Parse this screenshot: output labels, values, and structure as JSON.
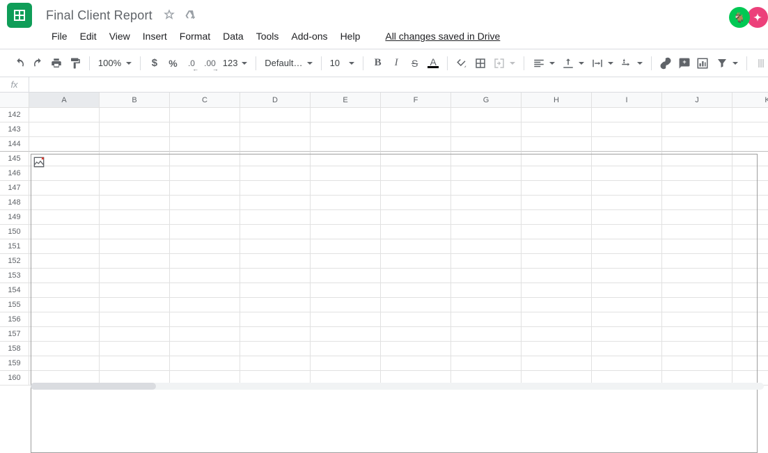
{
  "doc": {
    "title": "Final Client Report"
  },
  "save_status": "All changes saved in Drive",
  "avatars": {
    "a1": "🐐",
    "a2": "✦"
  },
  "menu": {
    "file": "File",
    "edit": "Edit",
    "view": "View",
    "insert": "Insert",
    "format": "Format",
    "data": "Data",
    "tools": "Tools",
    "addons": "Add-ons",
    "help": "Help"
  },
  "toolbar": {
    "zoom": "100%",
    "font": "Default (Ari...",
    "font_size": "10",
    "currency": "$",
    "percent": "%",
    "dec_less": ".0",
    "dec_more": ".00",
    "more_fmt": "123"
  },
  "fx": {
    "label": "fx",
    "value": ""
  },
  "columns": [
    "A",
    "B",
    "C",
    "D",
    "E",
    "F",
    "G",
    "H",
    "I",
    "J",
    "K"
  ],
  "rows": [
    "142",
    "143",
    "144",
    "145",
    "146",
    "147",
    "148",
    "149",
    "150",
    "151",
    "152",
    "153",
    "154",
    "155",
    "156",
    "157",
    "158",
    "159",
    "160"
  ]
}
